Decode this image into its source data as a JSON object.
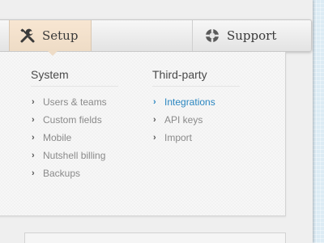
{
  "nav": {
    "setup_label": "Setup",
    "support_label": "Support",
    "setup_icon": "wrench-screwdriver-icon",
    "support_icon": "lifebuoy-icon"
  },
  "menu": {
    "system": {
      "heading": "System",
      "items": [
        {
          "label": "Users & teams"
        },
        {
          "label": "Custom fields"
        },
        {
          "label": "Mobile"
        },
        {
          "label": "Nutshell billing"
        },
        {
          "label": "Backups"
        }
      ]
    },
    "third_party": {
      "heading": "Third-party",
      "items": [
        {
          "label": "Integrations",
          "selected": true
        },
        {
          "label": "API keys"
        },
        {
          "label": "Import"
        }
      ]
    }
  },
  "colors": {
    "accent": "#2a86c0",
    "active_tab": "#f3e1cc",
    "page_background": "#dcebf4"
  }
}
